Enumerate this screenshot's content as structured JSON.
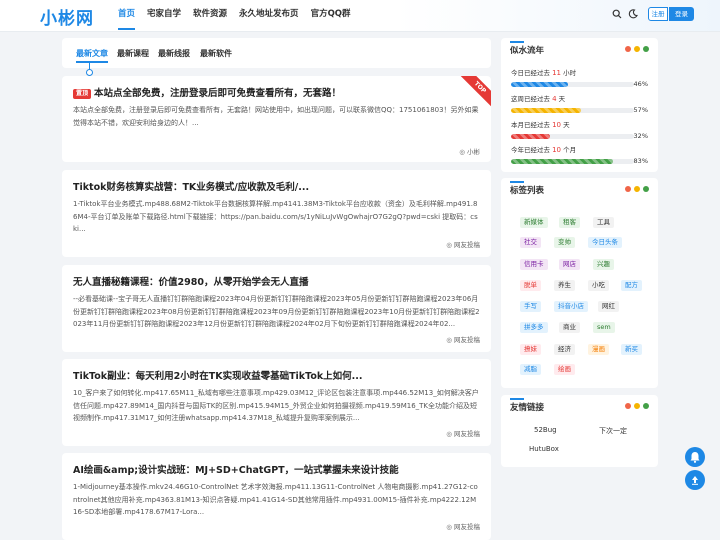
{
  "header": {
    "logo": "小彬网",
    "nav": [
      "首页",
      "宅家自学",
      "软件资源",
      "永久地址发布页",
      "官方QQ群"
    ],
    "register": "注册",
    "login": "登录",
    "icons": [
      "search-icon",
      "moon-icon",
      "user-icon"
    ]
  },
  "tabs": [
    "最新文章",
    "最新课程",
    "最新线报",
    "最新软件"
  ],
  "posts": [
    {
      "badge": "置顶",
      "ribbon": "TOP",
      "title": "本站点全部免费，注册登录后即可免费查看所有，无套路！",
      "excerpt": "本站点全部免费，注册登录后即可免费查看所有，无套路！网站使用中，如出现问题，可以联系微信QQ：1751061803！另外如果觉得本站不错，欢迎安利给身边的人！...",
      "author": "小彬"
    },
    {
      "title": "Tiktok财务核算实战营：TK业务模式/应收款及毛利/...",
      "excerpt": "1-Tiktok平台业务模式.mp488.68M2-Tiktok平台数据核算样解.mp4141.38M3-Tiktok平台应收款（资金）及毛利样解.mp491.86M4-平台订单及账单下载路径.html下载链接：https://pan.baidu.com/s/1yNiLuJvWgOwhajrO7G2gQ?pwd=cski 提取码：cski...",
      "author": "网友投稿"
    },
    {
      "title": "无人直播秘籍课程：价值2980，从零开始学会无人直播",
      "excerpt": "--必看基础课--宝子哥无人直播钉钉群陪跑课程2023年04月份更新钉钉群陪跑课程2023年05月份更新钉钉群陪跑课程2023年06月份更新钉钉群陪跑课程2023年08月份更新钉钉群陪跑课程2023年09月份更新钉钉群陪跑课程2023年10月份更新钉钉群陪跑课程2023年11月份更新钉钉群陪跑课程2023年12月份更新钉钉群陪跑课程2024年02月下旬份更新钉钉群陪跑课程2024年02...",
      "author": "网友投稿"
    },
    {
      "title": "TikTok副业：每天利用2小时在TK实现收益零基础TikTok上如何...",
      "excerpt": "10_客户来了如何转化.mp417.65M11_私域有哪些注意事项.mp429.03M12_评论区包装注意事项.mp446.52M13_如何解决客户信任问题.mp427.89M14_国内抖音与国际TK的区别.mp415.94M15_外贸企业如何拍摄视频.mp419.59M16_TK全功能介绍及短视频制作.mp417.31M17_如何注册whatsapp.mp414.37M18_私域提升复购率案例展示...",
      "author": "网友投稿"
    },
    {
      "title": "AI绘画&amp;设计实战班：MJ+SD+ChatGPT，一站式掌握未来设计技能",
      "excerpt": "1-Midjourney基本操作.mkv24.46G10-ControlNet 艺术字效海报.mp411.13G11-ControlNet 人物电商摄影.mp41.27G12-controlnet其他应用补充.mp4363.81M13-知识点答疑.mp41.41G14-SD其他常用插件.mp4931.00M15-插件补充.mp4222.12M16-SD本地部署.mp4178.67M17-Lora...",
      "author": "网友投稿"
    }
  ],
  "sidebar": {
    "progress": {
      "title": "似水流年",
      "items": [
        {
          "pre": "今日已经过去",
          "num": "11",
          "unit": "小时",
          "pct": 46,
          "pct_label": "46%",
          "color": "#1e88e5"
        },
        {
          "pre": "这周已经过去",
          "num": "4",
          "unit": "天",
          "pct": 57,
          "pct_label": "57%",
          "color": "#f5b400"
        },
        {
          "pre": "本月已经过去",
          "num": "10",
          "unit": "天",
          "pct": 32,
          "pct_label": "32%",
          "color": "#e53935"
        },
        {
          "pre": "今年已经过去",
          "num": "10",
          "unit": "个月",
          "pct": 83,
          "pct_label": "83%",
          "color": "#43a047"
        }
      ]
    },
    "tags": {
      "title": "标签列表",
      "items": [
        {
          "label": "新媒体",
          "color": "#2e7d32",
          "bg": "#e8f5e9"
        },
        {
          "label": "租客",
          "color": "#2e7d32",
          "bg": "#e8f5e9"
        },
        {
          "label": "工具",
          "color": "#333333",
          "bg": "#f2f2f2"
        },
        {
          "label": "社交",
          "color": "#7b1fa2",
          "bg": "#f3e5f5"
        },
        {
          "label": "变帅",
          "color": "#2e7d32",
          "bg": "#e8f5e9"
        },
        {
          "label": "今日头条",
          "color": "#1e88e5",
          "bg": "#e3f2fd"
        },
        {
          "label": "信用卡",
          "color": "#7b1fa2",
          "bg": "#f3e5f5"
        },
        {
          "label": "网店",
          "color": "#7b1fa2",
          "bg": "#f3e5f5"
        },
        {
          "label": "兴趣",
          "color": "#2e7d32",
          "bg": "#e8f5e9"
        },
        {
          "label": "脱单",
          "color": "#e53935",
          "bg": "#ffebee"
        },
        {
          "label": "养生",
          "color": "#333333",
          "bg": "#f2f2f2"
        },
        {
          "label": "小吃",
          "color": "#333333",
          "bg": "#f2f2f2"
        },
        {
          "label": "配方",
          "color": "#1e88e5",
          "bg": "#e3f2fd"
        },
        {
          "label": "手写",
          "color": "#1e88e5",
          "bg": "#e3f2fd"
        },
        {
          "label": "抖音小店",
          "color": "#1e88e5",
          "bg": "#e3f2fd"
        },
        {
          "label": "网红",
          "color": "#333333",
          "bg": "#f2f2f2"
        },
        {
          "label": "拼多多",
          "color": "#1e88e5",
          "bg": "#e3f2fd"
        },
        {
          "label": "商业",
          "color": "#333333",
          "bg": "#f2f2f2"
        },
        {
          "label": "sem",
          "color": "#2e7d32",
          "bg": "#e8f5e9"
        },
        {
          "label": "撩妹",
          "color": "#e53935",
          "bg": "#ffebee"
        },
        {
          "label": "经济",
          "color": "#333333",
          "bg": "#f2f2f2"
        },
        {
          "label": "漫画",
          "color": "#f57c00",
          "bg": "#fff3e0"
        },
        {
          "label": "新买",
          "color": "#1e88e5",
          "bg": "#e3f2fd"
        },
        {
          "label": "减脂",
          "color": "#1e88e5",
          "bg": "#e3f2fd"
        },
        {
          "label": "绘画",
          "color": "#e53935",
          "bg": "#ffebee"
        }
      ]
    },
    "links": {
      "title": "友情链接",
      "items": [
        "52Bug",
        "下次一定",
        "HutuBox"
      ]
    },
    "dot_colors": [
      "#f06548",
      "#f5b400",
      "#43a047"
    ]
  },
  "floating": [
    "bell-icon",
    "arrow-up-icon"
  ]
}
